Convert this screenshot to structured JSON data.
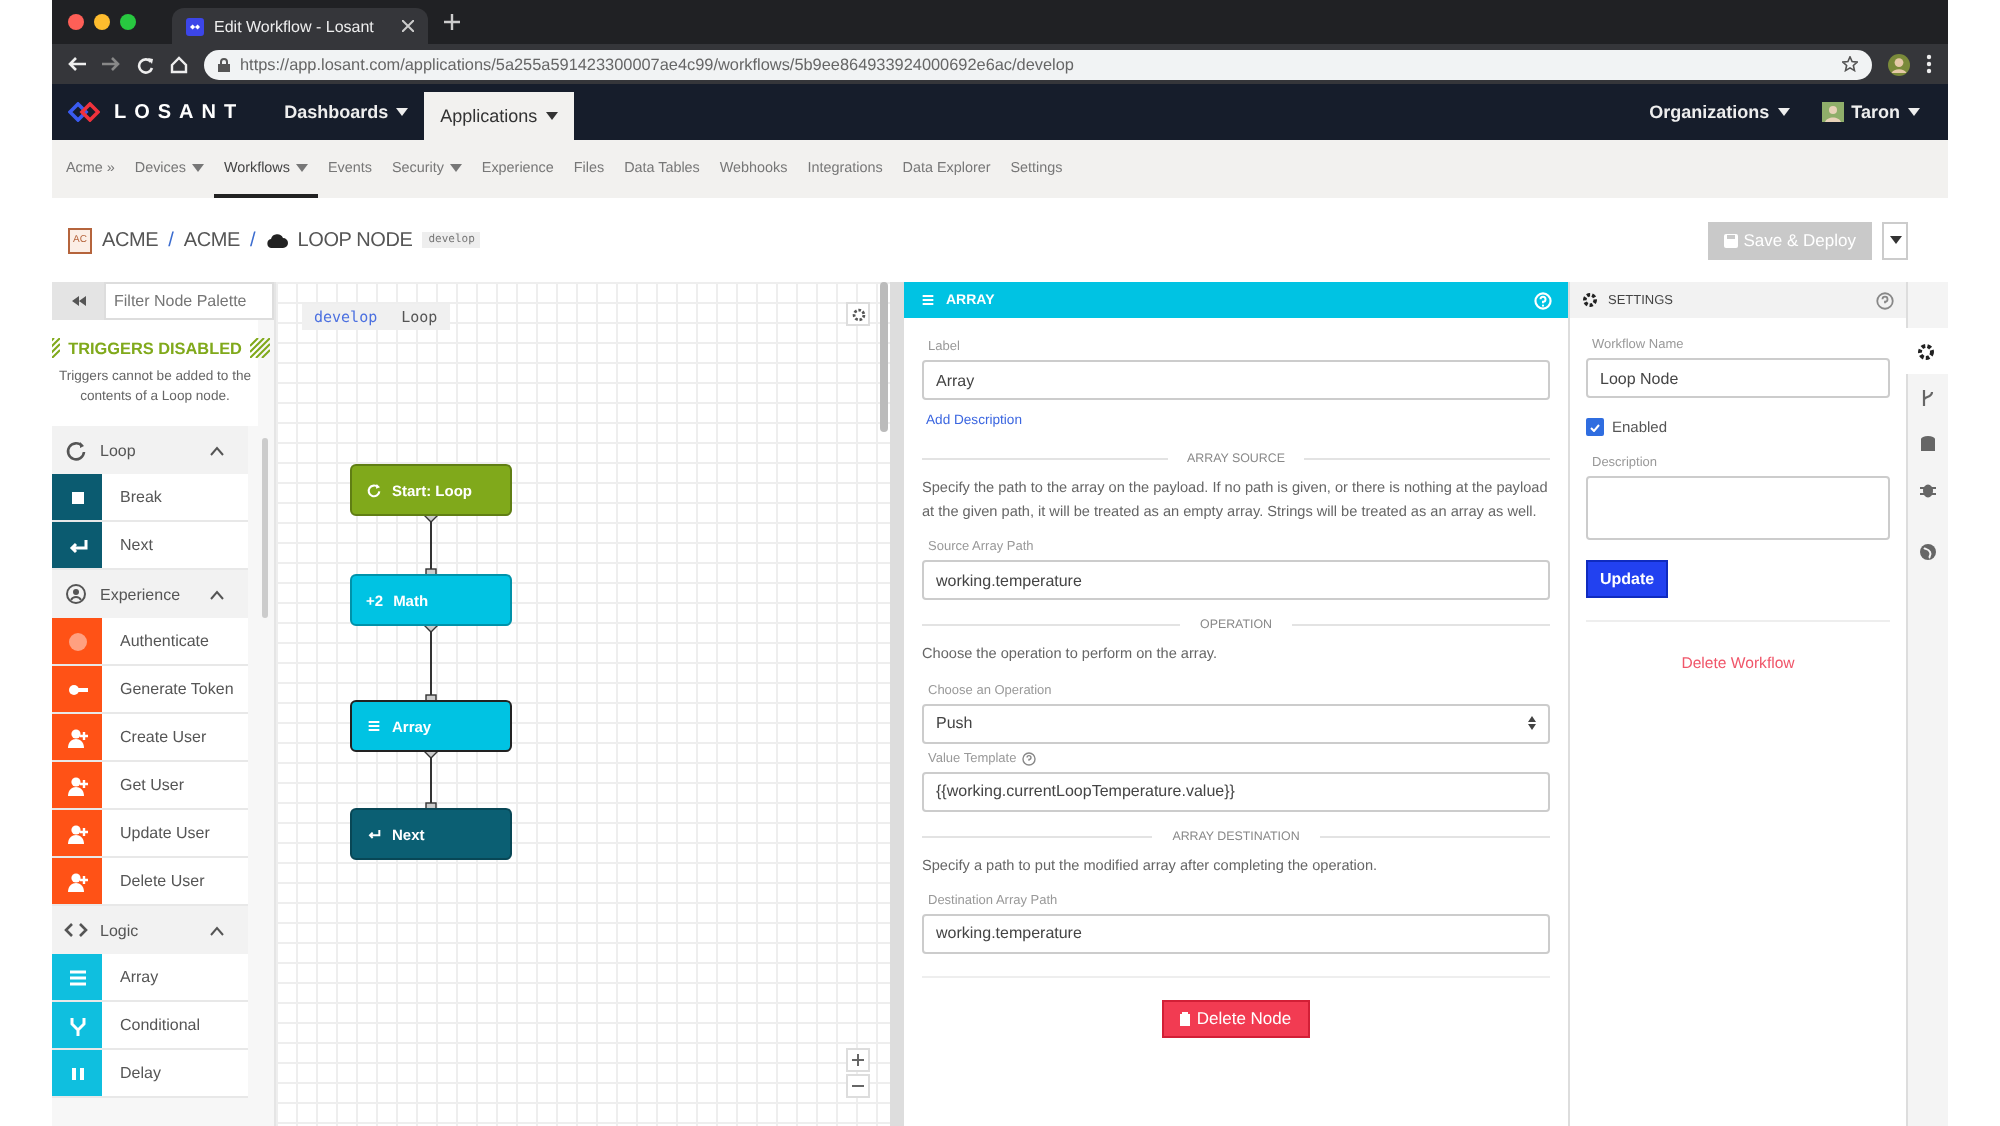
{
  "browser": {
    "tab_title": "Edit Workflow - Losant",
    "url": "https://app.losant.com/applications/5a255a591423300007ae4c99/workflows/5b9ee864933924000692e6ac/develop"
  },
  "nav": {
    "logo": "LOSANT",
    "menus": [
      {
        "label": "Dashboards",
        "selected": false
      },
      {
        "label": "Applications",
        "selected": true
      }
    ],
    "organizations": "Organizations",
    "user": "Taron"
  },
  "subnav": [
    {
      "label": "Acme »",
      "dropdown": false,
      "selected": false
    },
    {
      "label": "Devices",
      "dropdown": true,
      "selected": false
    },
    {
      "label": "Workflows",
      "dropdown": true,
      "selected": true
    },
    {
      "label": "Events",
      "dropdown": false,
      "selected": false
    },
    {
      "label": "Security",
      "dropdown": true,
      "selected": false
    },
    {
      "label": "Experience",
      "dropdown": false,
      "selected": false
    },
    {
      "label": "Files",
      "dropdown": false,
      "selected": false
    },
    {
      "label": "Data Tables",
      "dropdown": false,
      "selected": false
    },
    {
      "label": "Webhooks",
      "dropdown": false,
      "selected": false
    },
    {
      "label": "Integrations",
      "dropdown": false,
      "selected": false
    },
    {
      "label": "Data Explorer",
      "dropdown": false,
      "selected": false
    },
    {
      "label": "Settings",
      "dropdown": false,
      "selected": false
    }
  ],
  "breadcrumb": {
    "app_badge": "AC",
    "items": [
      "ACME",
      "ACME",
      "LOOP NODE"
    ],
    "separator": "/",
    "version": "develop"
  },
  "save_button": {
    "label": "Save & Deploy",
    "disabled": true
  },
  "palette": {
    "filter_placeholder": "Filter Node Palette",
    "notice_title": "TRIGGERS DISABLED",
    "notice_text": "Triggers cannot be added to the contents of a Loop node.",
    "groups": [
      {
        "name": "Loop",
        "expanded": true,
        "color": "#0b5b70",
        "items": [
          "Break",
          "Next"
        ]
      },
      {
        "name": "Experience",
        "expanded": true,
        "color": "#ff5216",
        "items": [
          "Authenticate",
          "Generate Token",
          "Create User",
          "Get User",
          "Update User",
          "Delete User"
        ]
      },
      {
        "name": "Logic",
        "expanded": true,
        "color": "#0fbfdf",
        "items": [
          "Array",
          "Conditional",
          "Delay"
        ]
      }
    ]
  },
  "canvas": {
    "path": [
      "develop",
      "Loop"
    ],
    "nodes": [
      {
        "label": "Start: Loop",
        "kind": "start",
        "selected": false
      },
      {
        "label": "Math",
        "kind": "logic",
        "icon_text": "+2",
        "selected": false
      },
      {
        "label": "Array",
        "kind": "logic",
        "selected": true
      },
      {
        "label": "Next",
        "kind": "loop",
        "selected": false
      }
    ]
  },
  "editor": {
    "title": "ARRAY",
    "blocks": [
      {
        "kind": "field",
        "label": "Label",
        "value": "Array"
      },
      {
        "kind": "link",
        "text": "Add Description"
      },
      {
        "kind": "divider",
        "text": "ARRAY SOURCE"
      },
      {
        "kind": "paragraph",
        "text": "Specify the path to the array on the payload. If no path is given, or there is nothing at the payload at the given path, it will be treated as an empty array. Strings will be treated as an array as well."
      },
      {
        "kind": "field",
        "label": "Source Array Path",
        "value": "working.temperature"
      },
      {
        "kind": "divider",
        "text": "OPERATION"
      },
      {
        "kind": "paragraph",
        "text": "Choose the operation to perform on the array."
      },
      {
        "kind": "select",
        "label": "Choose an Operation",
        "value": "Push"
      },
      {
        "kind": "field",
        "label": "Value Template",
        "value": "{{working.currentLoopTemperature.value}}",
        "help": true
      },
      {
        "kind": "divider",
        "text": "ARRAY DESTINATION"
      },
      {
        "kind": "paragraph",
        "text": "Specify a path to put the modified array after completing the operation."
      },
      {
        "kind": "field",
        "label": "Destination Array Path",
        "value": "working.temperature"
      },
      {
        "kind": "danger_button",
        "text": "Delete Node"
      }
    ]
  },
  "settings": {
    "title": "SETTINGS",
    "name_label": "Workflow Name",
    "name_value": "Loop Node",
    "enabled_label": "Enabled",
    "enabled": true,
    "description_label": "Description",
    "update_label": "Update",
    "delete_label": "Delete Workflow"
  },
  "rail": [
    {
      "selected": true
    },
    {
      "selected": false
    },
    {
      "selected": false
    },
    {
      "selected": false
    },
    {
      "selected": false
    }
  ]
}
